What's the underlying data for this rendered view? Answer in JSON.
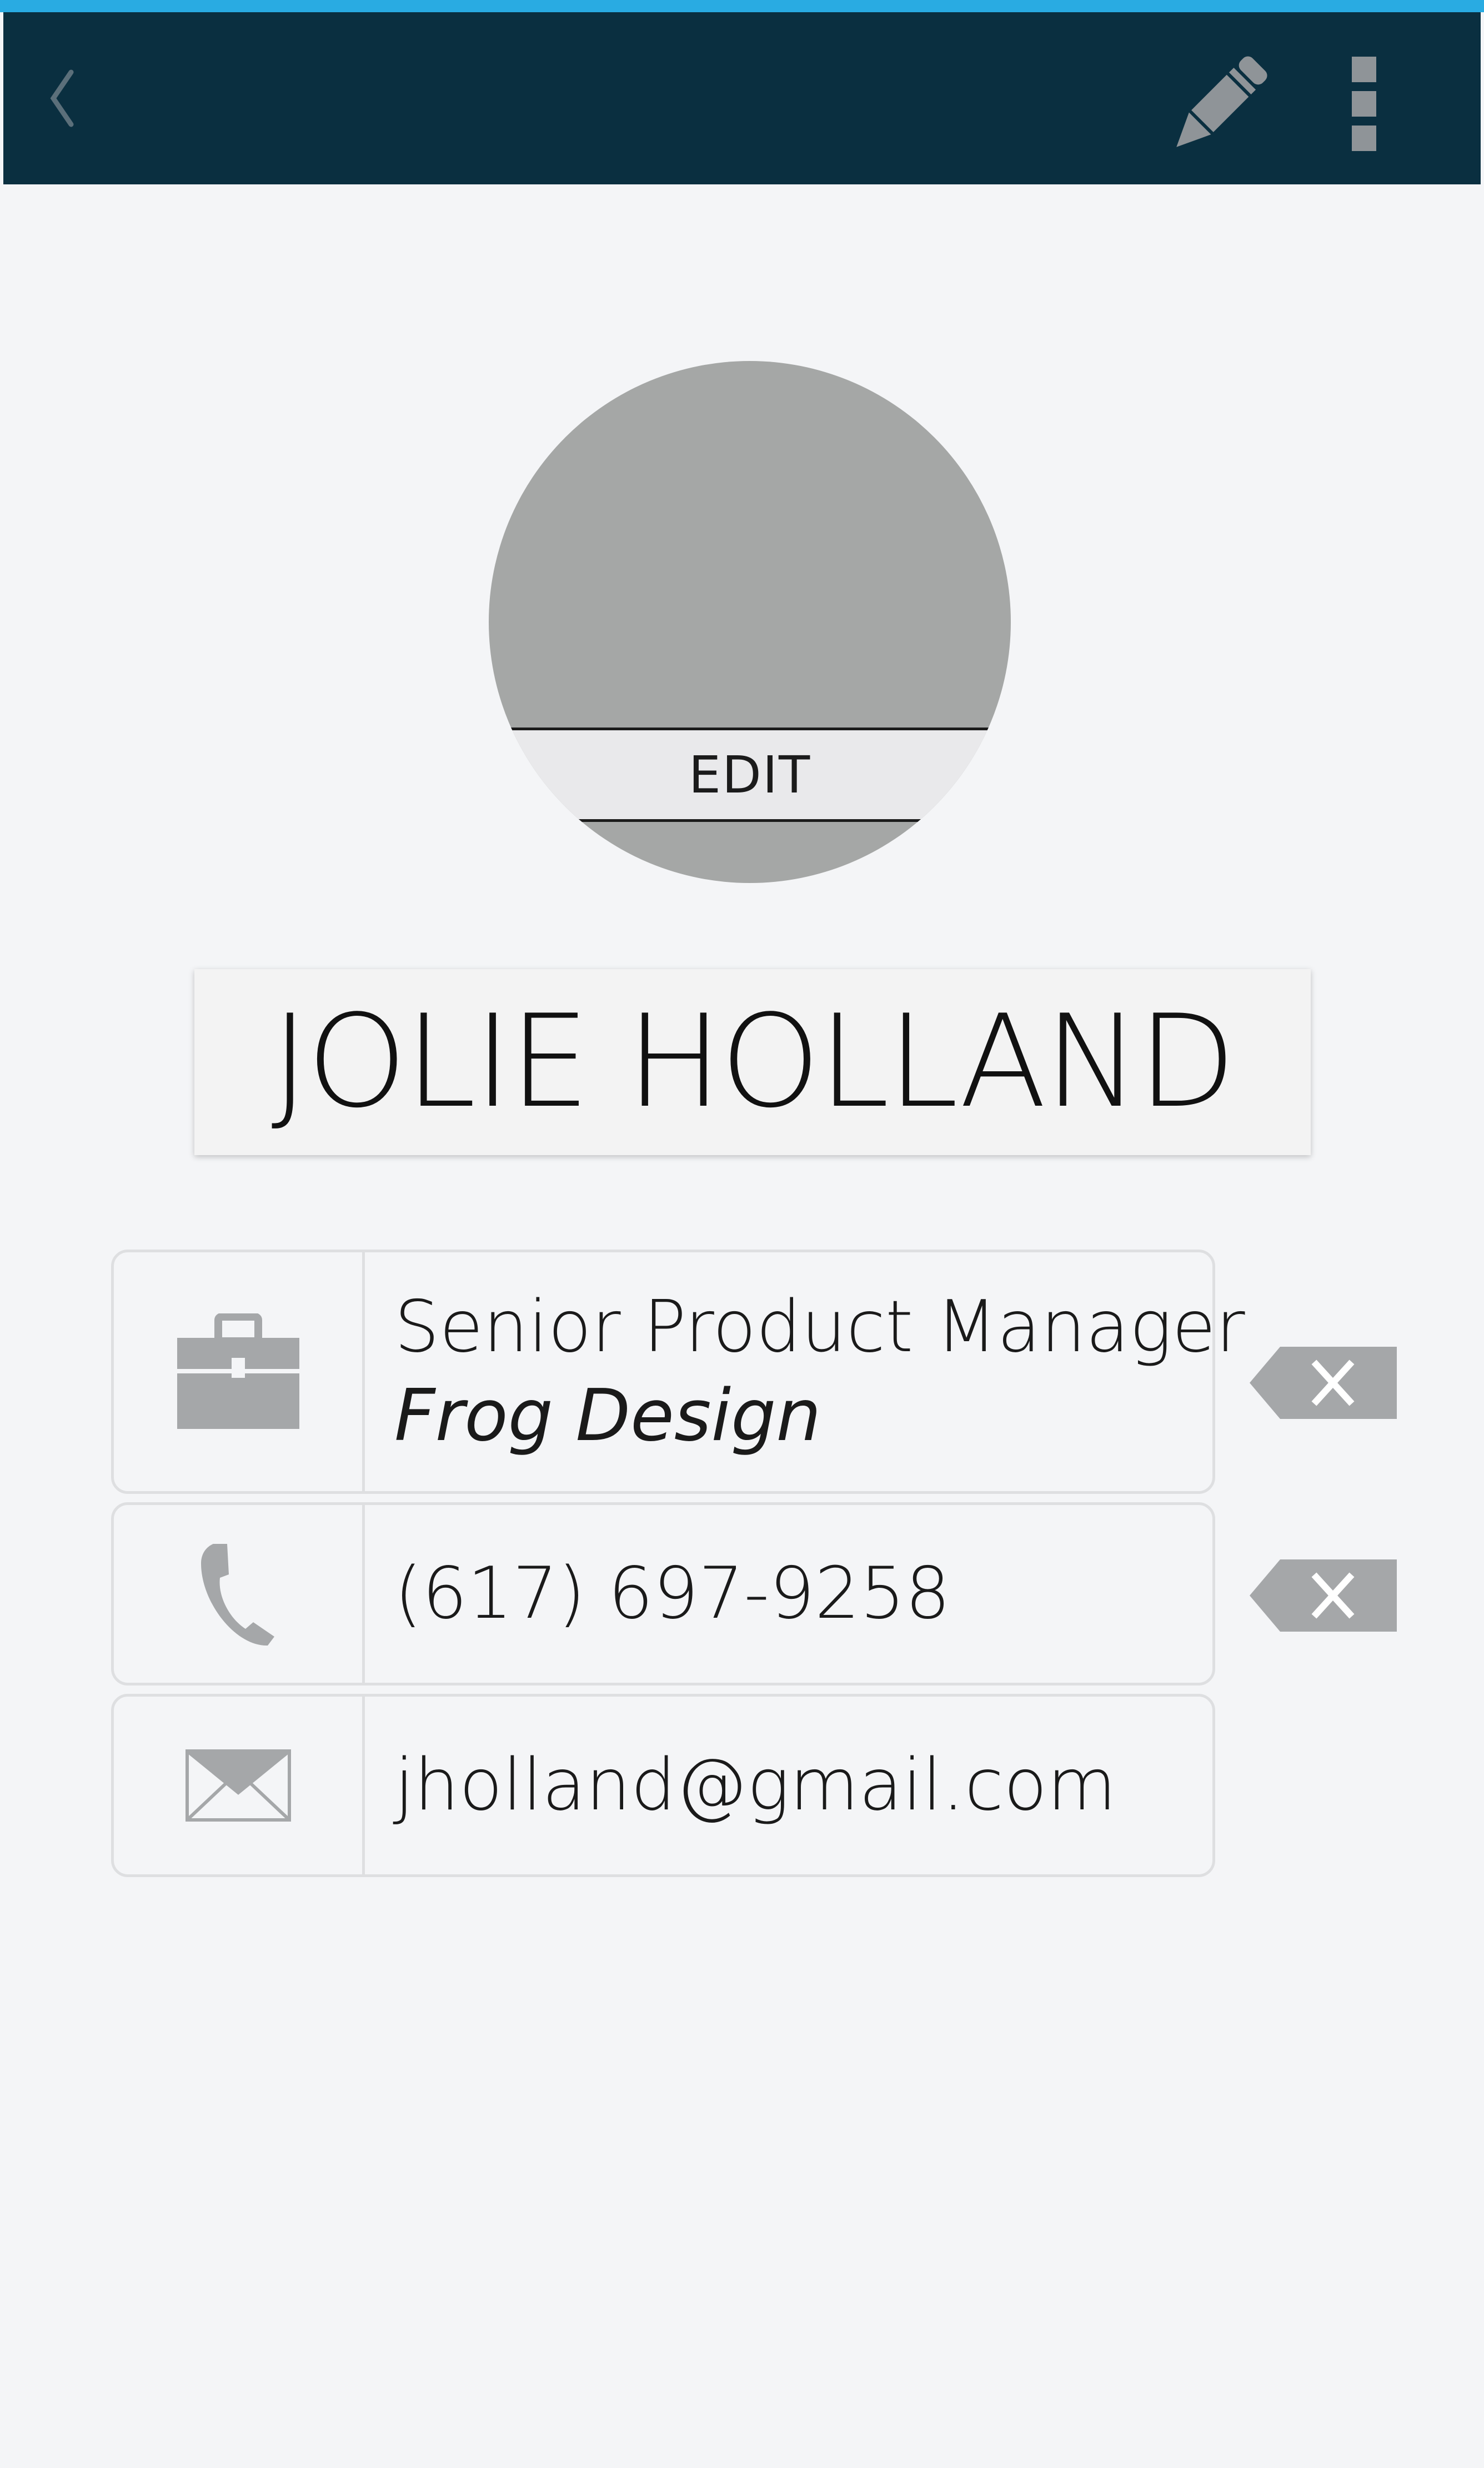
{
  "contact": {
    "avatar_edit_label": "EDIT",
    "name": "JOLIE HOLLAND",
    "job": {
      "title": "Senior Product Manager",
      "company": "Frog Design",
      "icon": "briefcase-icon"
    },
    "phone": {
      "value": "(617) 697-9258",
      "icon": "phone-icon"
    },
    "email": {
      "value": "jholland@gmail.com",
      "icon": "envelope-icon"
    }
  },
  "toolbar": {
    "back_icon": "back-chevron-icon",
    "edit_icon": "pencil-icon",
    "menu_icon": "overflow-menu-icon"
  },
  "colors": {
    "accent_stripe": "#29abe2",
    "appbar": "#0a2f40",
    "icon_gray": "#a5a7a9",
    "background": "#f4f5f7"
  }
}
